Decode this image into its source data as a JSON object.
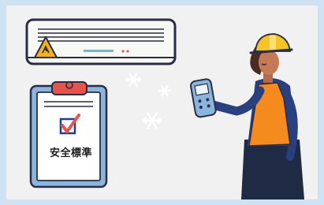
{
  "clipboard": {
    "label": "安全標準",
    "checkbox_checked": true
  },
  "colors": {
    "frame": "#cfe2f4",
    "background": "#f1f1f2",
    "ac_body": "#f7f7f5",
    "warning_sign": "#f2b21b",
    "helmet": "#f5c527",
    "vest": "#f58a1f",
    "check_mark": "#1f3f8f",
    "clip": "#e8534a",
    "snowflake": "#ffffff"
  },
  "icons": [
    "warning-icon",
    "snowflake-icon",
    "check-icon",
    "remote-control-icon"
  ]
}
